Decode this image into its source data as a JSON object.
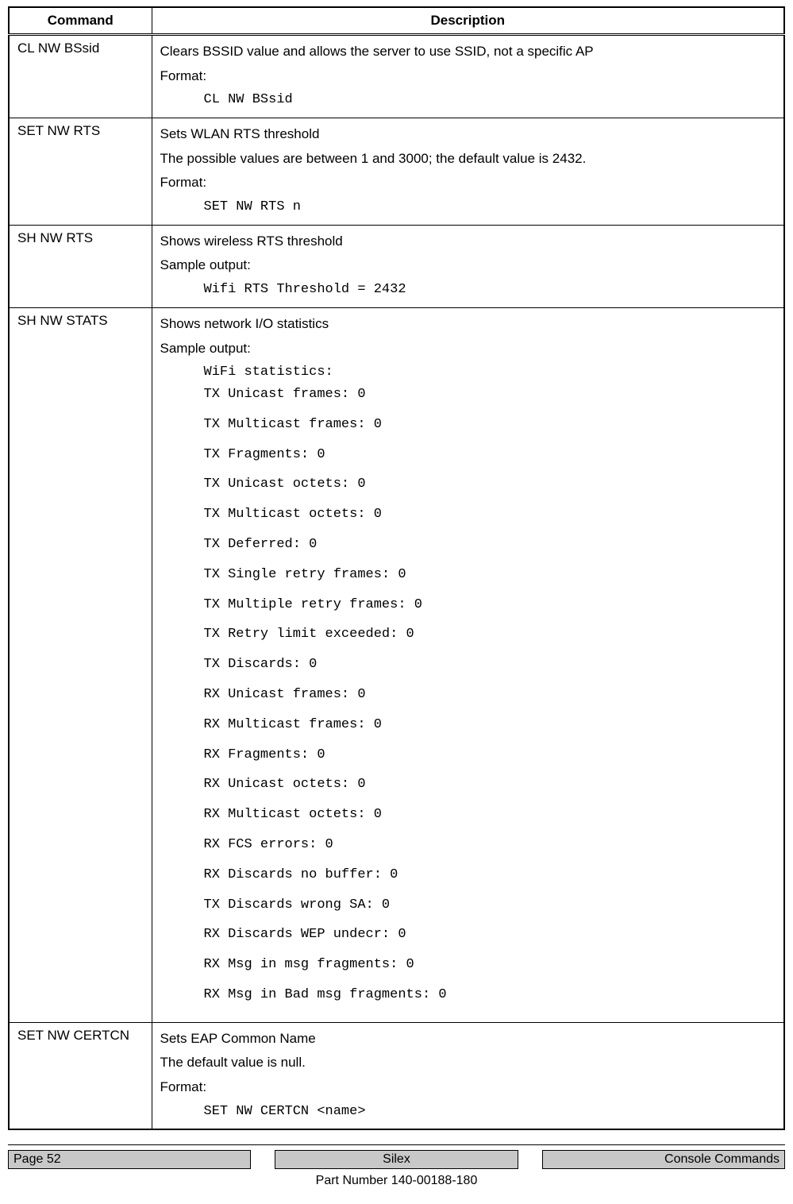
{
  "table": {
    "headers": {
      "command": "Command",
      "description": "Description"
    },
    "rows": [
      {
        "command": "CL NW BSsid",
        "desc1": "Clears BSSID value and allows the server to use SSID, not a specific AP",
        "desc2": "Format:",
        "code1": "CL NW BSsid"
      },
      {
        "command": "SET NW RTS",
        "desc1": "Sets WLAN RTS threshold",
        "desc2": "The possible values are between 1 and 3000; the default value is 2432.",
        "desc3": "Format:",
        "code1": "SET NW RTS    n"
      },
      {
        "command": "SH NW RTS",
        "desc1": "Shows wireless RTS threshold",
        "desc2": "Sample output:",
        "code1": "Wifi RTS Threshold = 2432"
      },
      {
        "command": "SH NW STATS",
        "desc1": "Shows network I/O statistics",
        "desc2": "Sample output:",
        "codes": [
          "WiFi statistics:",
          "TX Unicast frames: 0",
          "TX Multicast frames: 0",
          "TX Fragments: 0",
          "TX Unicast octets: 0",
          "TX Multicast octets: 0",
          "TX Deferred: 0",
          "TX Single retry frames: 0",
          "TX Multiple retry frames: 0",
          "TX Retry limit exceeded: 0",
          "TX Discards: 0",
          "RX Unicast frames: 0",
          "RX Multicast frames: 0",
          "RX Fragments: 0",
          "RX Unicast octets: 0",
          "RX Multicast octets: 0",
          "RX FCS errors: 0",
          "RX Discards no buffer: 0",
          "TX Discards wrong SA: 0",
          "RX Discards WEP undecr: 0",
          "RX Msg in msg fragments: 0",
          "RX Msg in Bad msg fragments: 0"
        ]
      },
      {
        "command": "SET NW CERTCN",
        "desc1": "Sets EAP Common Name",
        "desc2": "The default value is null.",
        "desc3": "Format:",
        "code1": "SET NW CERTCN   <name>"
      }
    ]
  },
  "footer": {
    "left": "Page 52",
    "center": "Silex",
    "right": "Console Commands",
    "part": "Part Number 140-00188-180"
  }
}
